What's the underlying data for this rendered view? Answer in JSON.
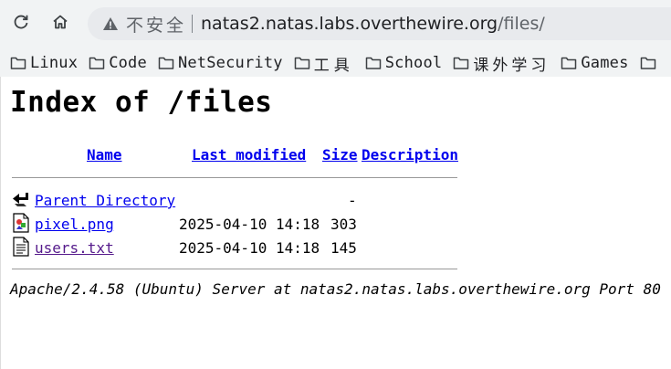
{
  "browser": {
    "security_label": "不安全",
    "url_host": "natas2.natas.labs.overthewire.org",
    "url_path": "/files/"
  },
  "bookmarks": [
    {
      "label": "Linux"
    },
    {
      "label": "Code"
    },
    {
      "label": "NetSecurity"
    },
    {
      "label": "工具"
    },
    {
      "label": "School"
    },
    {
      "label": "课外学习"
    },
    {
      "label": "Games"
    }
  ],
  "page": {
    "title": "Index of /files",
    "columns": {
      "name": "Name",
      "last_modified": "Last modified",
      "size": "Size",
      "description": "Description"
    },
    "rows": [
      {
        "icon": "back-icon",
        "name": "Parent Directory",
        "modified": "",
        "size": "-"
      },
      {
        "icon": "image-icon",
        "name": "pixel.png",
        "modified": "2025-04-10 14:18",
        "size": "303"
      },
      {
        "icon": "text-file-icon",
        "name": "users.txt",
        "modified": "2025-04-10 14:18",
        "size": "145"
      }
    ],
    "footer": "Apache/2.4.58 (Ubuntu) Server at natas2.natas.labs.overthewire.org Port 80"
  }
}
